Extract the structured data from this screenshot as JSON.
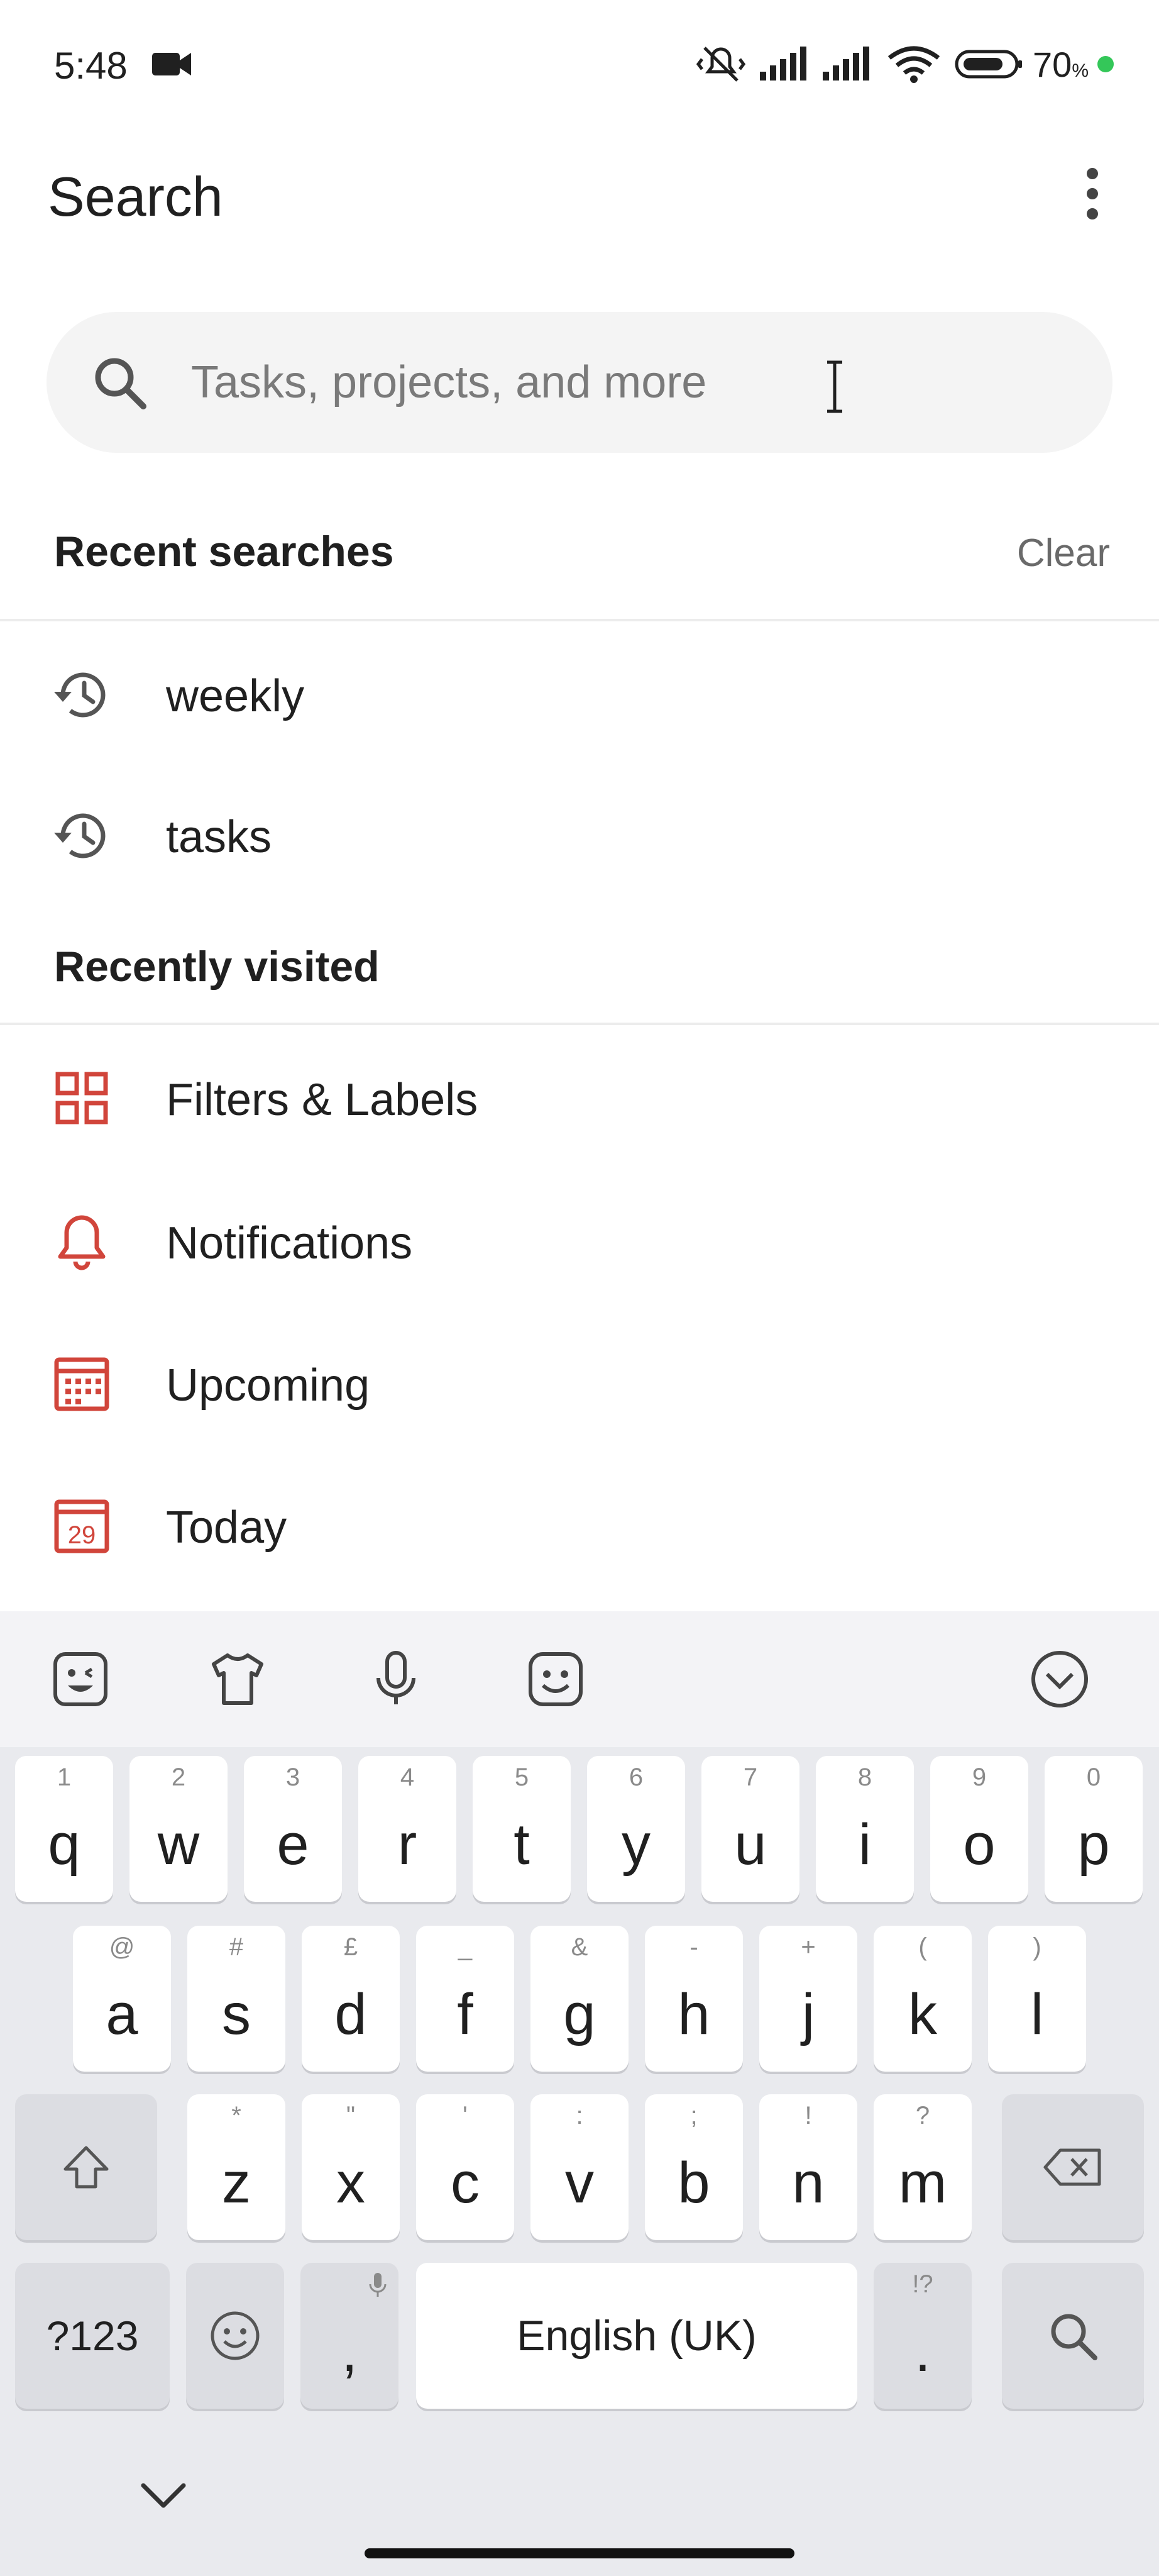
{
  "status_bar": {
    "time": "5:48",
    "battery": "70",
    "battery_unit": "%",
    "icons": [
      "video-camera-icon",
      "muted-vibrate-icon",
      "signal-icon",
      "signal-icon",
      "wifi-icon",
      "battery-icon"
    ]
  },
  "header": {
    "title": "Search",
    "more_icon": "more-vertical-icon"
  },
  "search": {
    "placeholder": "Tasks, projects, and more",
    "value": ""
  },
  "recent_searches": {
    "title": "Recent searches",
    "clear_label": "Clear",
    "items": [
      {
        "label": "weekly",
        "icon": "history-icon"
      },
      {
        "label": "tasks",
        "icon": "history-icon"
      }
    ]
  },
  "recently_visited": {
    "title": "Recently visited",
    "items": [
      {
        "label": "Filters & Labels",
        "icon": "grid-icon"
      },
      {
        "label": "Notifications",
        "icon": "bell-icon"
      },
      {
        "label": "Upcoming",
        "icon": "calendar-grid-icon"
      },
      {
        "label": "Today",
        "icon": "calendar-today-icon",
        "badge": "29"
      }
    ]
  },
  "colors": {
    "accent": "#d1453b",
    "text": "#202020",
    "muted": "#6a6a6a",
    "search_bg": "#f4f4f4",
    "keyboard_bg": "#e9eaee"
  },
  "keyboard": {
    "row1": [
      {
        "main": "q",
        "hint": "1"
      },
      {
        "main": "w",
        "hint": "2"
      },
      {
        "main": "e",
        "hint": "3"
      },
      {
        "main": "r",
        "hint": "4"
      },
      {
        "main": "t",
        "hint": "5"
      },
      {
        "main": "y",
        "hint": "6"
      },
      {
        "main": "u",
        "hint": "7"
      },
      {
        "main": "i",
        "hint": "8"
      },
      {
        "main": "o",
        "hint": "9"
      },
      {
        "main": "p",
        "hint": "0"
      }
    ],
    "row2": [
      {
        "main": "a",
        "hint": "@"
      },
      {
        "main": "s",
        "hint": "#"
      },
      {
        "main": "d",
        "hint": "£"
      },
      {
        "main": "f",
        "hint": "_"
      },
      {
        "main": "g",
        "hint": "&"
      },
      {
        "main": "h",
        "hint": "-"
      },
      {
        "main": "j",
        "hint": "+"
      },
      {
        "main": "k",
        "hint": "("
      },
      {
        "main": "l",
        "hint": ")"
      }
    ],
    "row3": [
      {
        "main": "z",
        "hint": "*"
      },
      {
        "main": "x",
        "hint": "\""
      },
      {
        "main": "c",
        "hint": "'"
      },
      {
        "main": "v",
        "hint": ":"
      },
      {
        "main": "b",
        "hint": ";"
      },
      {
        "main": "n",
        "hint": "!"
      },
      {
        "main": "m",
        "hint": "?"
      }
    ],
    "symbols_label": "?123",
    "comma": ",",
    "space_label": "English (UK)",
    "period": ".",
    "period_hint": "!?",
    "toolbar_icons": [
      "sticker-icon",
      "theme-icon",
      "microphone-icon",
      "emoji-face-icon",
      "collapse-toolbar-icon"
    ]
  }
}
